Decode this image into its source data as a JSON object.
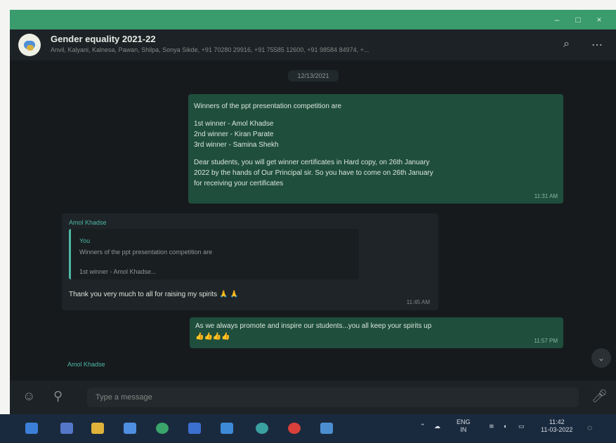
{
  "window": {
    "controls": {
      "minimize": "–",
      "maximize": "□",
      "close": "×"
    }
  },
  "header": {
    "group_name": "Gender equality 2021-22",
    "participants": "Anvil, Kalyani, Kalnesa, Pawan, Shilpa, Sonya Sikde, +91 70280 29916, +91 75585 12600, +91 98584 84974, +...",
    "search_icon": "search-icon",
    "menu_icon": "more-icon"
  },
  "date_chip": "12/13/2021",
  "messages": [
    {
      "type": "outgoing",
      "lines": [
        "Winners of the ppt presentation competition are",
        "",
        "1st  winner - Amol Khadse",
        "2nd winner - Kiran Parate",
        "3rd winner - Samina Shekh",
        "",
        "Dear students, you will get winner certificates in Hard copy, on 26th January",
        "2022 by the hands of Our Principal sir. So you have to come on 26th January",
        "for receiving your certificates"
      ],
      "time": "11:31 AM"
    },
    {
      "type": "incoming",
      "sender": "Amol Khadse",
      "quote_author": "You",
      "quote_line1": "Winners of the ppt presentation competition are",
      "quote_line2": "1st  winner - Amol Khadse...",
      "text": "Thank you very much to all for raising my spirits",
      "emoji": "🙏 🙏",
      "time": "11:45 AM"
    },
    {
      "type": "outgoing",
      "text": "As we always  promote and inspire our students...you all keep your spirits up",
      "emoji": "👍👍👍👍",
      "time": "11:57 PM"
    }
  ],
  "typing_sender": "Amol Khadse",
  "composer": {
    "placeholder": "Type a message",
    "emoji_icon": "emoji-icon",
    "attach_icon": "attach-icon",
    "mic_icon": "mic-icon"
  },
  "taskbar": {
    "language": "ENG",
    "region": "IN",
    "time": "11:42",
    "date": "11-03-2022"
  },
  "colors": {
    "titlebar": "#3a9b6c",
    "outgoing_bubble": "#1f4e3c",
    "incoming_bubble": "#1e2427",
    "chat_bg": "#161a1d"
  }
}
